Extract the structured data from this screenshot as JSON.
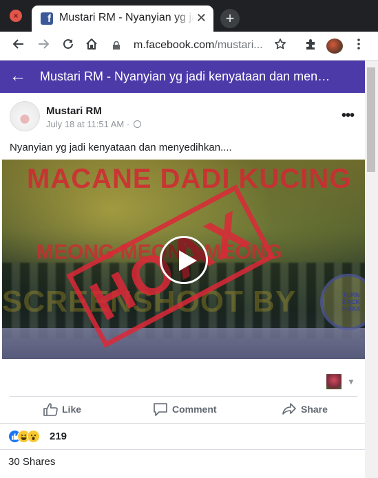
{
  "browser": {
    "tab_title": "Mustari RM - Nyanyian yg jadi kenyataan",
    "tab_close": "✕",
    "new_tab": "+",
    "url_host": "m.facebook.com",
    "url_path": "/mustari...",
    "icons": [
      "close-window-icon",
      "facebook-favicon",
      "back-icon",
      "forward-icon",
      "reload-icon",
      "home-icon",
      "lock-icon",
      "star-icon",
      "extensions-icon",
      "profile-avatar",
      "menu-icon"
    ]
  },
  "fb_header": {
    "back": "←",
    "title": "Mustari RM - Nyanyian yg jadi kenyataan dan men…",
    "color": "#4b3aa8"
  },
  "post": {
    "author": "Mustari RM",
    "timestamp": "July 18 at 11:51 AM · ",
    "more": "•••",
    "text": "Nyanyian yg jadi kenyataan dan menyedihkan....",
    "video": {
      "overlay_line1": "MACANE DADI KUCING",
      "overlay_line2": "MEONG MEONG MEONG",
      "stamp": "HOAX",
      "watermark": "SCREENSHOOT BY",
      "seal_text": "TURN BACK HOAX"
    }
  },
  "actions": {
    "like": "Like",
    "comment": "Comment",
    "share": "Share"
  },
  "reactions": {
    "count": "219",
    "types": [
      "like",
      "haha",
      "wow"
    ]
  },
  "shares": "30 Shares"
}
